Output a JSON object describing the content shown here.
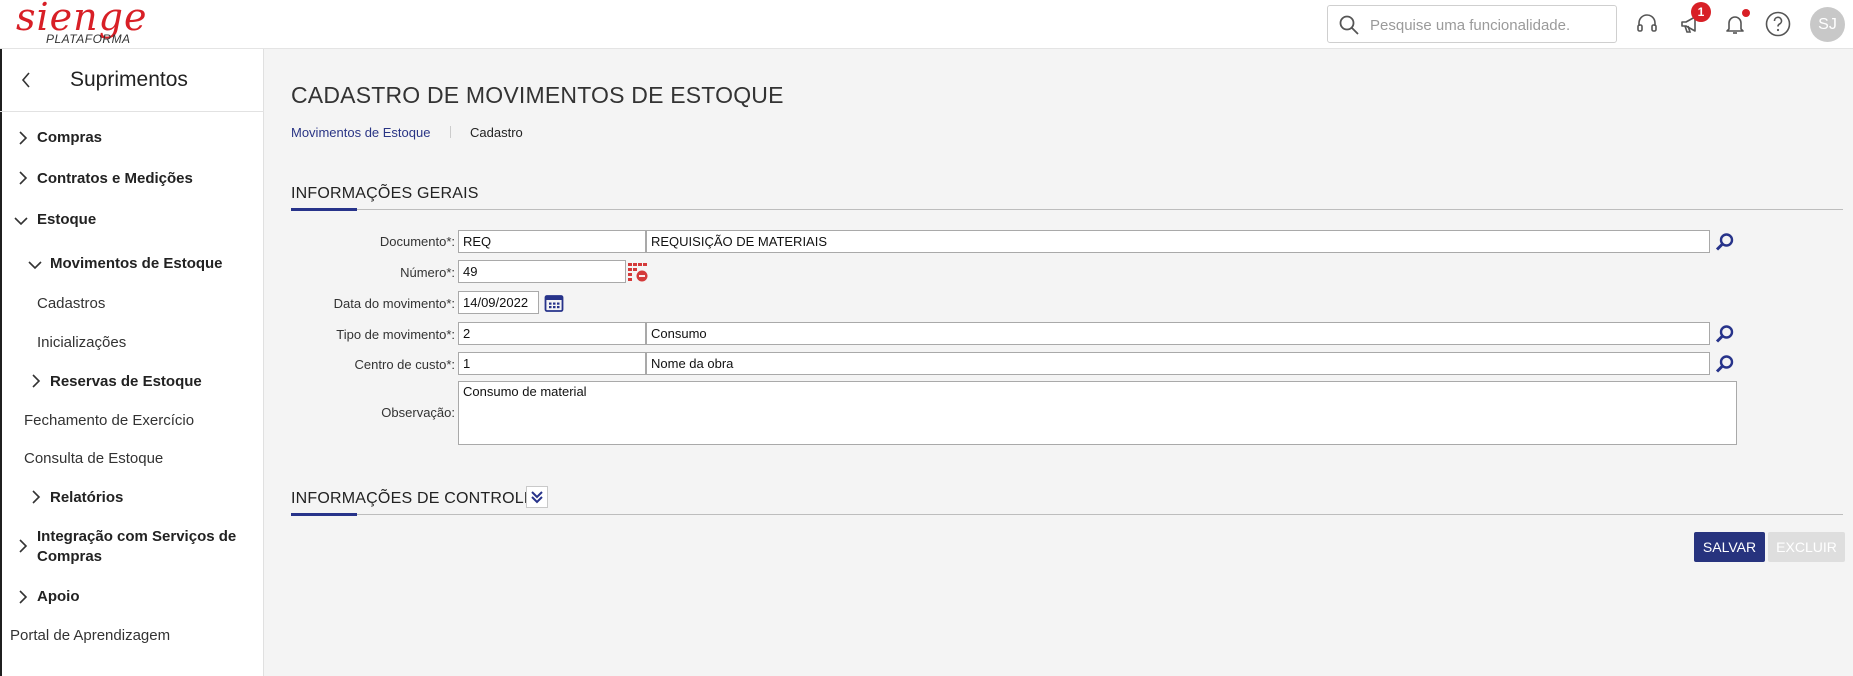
{
  "header": {
    "logo_text": "sienge",
    "logo_subtext": "PLATAFORMA",
    "search_placeholder": "Pesquise uma funcionalidade.",
    "notifications_badge": "1",
    "user_initials": "SJ",
    "icons": [
      "headset-icon",
      "megaphone-icon",
      "bell-icon",
      "help-icon"
    ]
  },
  "sidebar": {
    "title": "Suprimentos",
    "items": [
      {
        "label": "Compras",
        "expanded": false
      },
      {
        "label": "Contratos e Medições",
        "expanded": false
      },
      {
        "label": "Estoque",
        "expanded": true
      },
      {
        "label": "Movimentos de Estoque",
        "expanded": true
      },
      {
        "label": "Cadastros"
      },
      {
        "label": "Inicializações"
      },
      {
        "label": "Reservas de Estoque",
        "expanded": false
      },
      {
        "label": "Fechamento de Exercício"
      },
      {
        "label": "Consulta de Estoque"
      },
      {
        "label": "Relatórios",
        "expanded": false
      },
      {
        "label_line1": "Integração com Serviços de",
        "label_line2": "Compras",
        "expanded": false
      },
      {
        "label": "Apoio",
        "expanded": false
      },
      {
        "label": "Portal de Aprendizagem"
      }
    ]
  },
  "page": {
    "title": "CADASTRO DE MOVIMENTOS DE ESTOQUE",
    "breadcrumb": {
      "parent": "Movimentos de Estoque",
      "current": "Cadastro"
    }
  },
  "general_info": {
    "title": "INFORMAÇÕES GERAIS",
    "documento": {
      "label": "Documento*:",
      "code": "REQ",
      "description": "REQUISIÇÃO DE MATERIAIS"
    },
    "numero": {
      "label": "Número*:",
      "value": "49"
    },
    "data_movimento": {
      "label": "Data do movimento*:",
      "value": "14/09/2022"
    },
    "tipo_movimento": {
      "label": "Tipo de movimento*:",
      "code": "2",
      "description": "Consumo"
    },
    "centro_custo": {
      "label": "Centro de custo*:",
      "code": "1",
      "description": "Nome da obra"
    },
    "observacao": {
      "label": "Observação:",
      "value": "Consumo de material"
    }
  },
  "control_info": {
    "title": "INFORMAÇÕES DE CONTROLE"
  },
  "actions": {
    "save": "SALVAR",
    "delete": "EXCLUIR"
  },
  "colors": {
    "brand_red": "#d81f26",
    "primary_blue": "#27337e",
    "link_blue": "#2a3585"
  }
}
